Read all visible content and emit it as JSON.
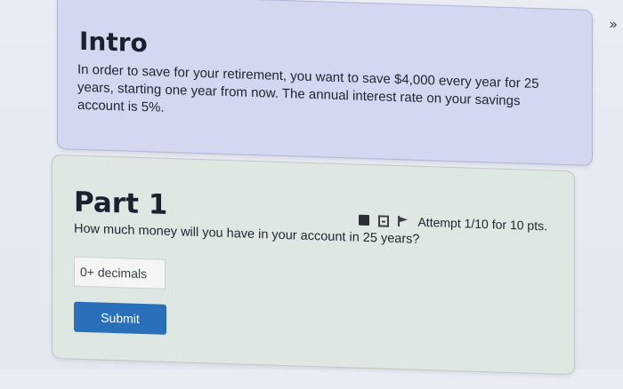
{
  "intro": {
    "title": "Intro",
    "text": "In order to save for your retirement, you want to save $4,000 every year for 25 years, starting one year from now. The annual interest rate on your savings account is 5%."
  },
  "part1": {
    "title": "Part 1",
    "attempt": "Attempt 1/10 for 10 pts.",
    "question": "How much money will you have in your account in 25 years?",
    "answer_placeholder": "0+ decimals",
    "answer_value": "",
    "submit_label": "Submit"
  },
  "icons": [
    "calculator-icon",
    "document-icon",
    "flag-icon"
  ],
  "colors": {
    "intro_bg": "#d3d8f0",
    "part_bg": "#dfe7e3",
    "submit_bg": "#2a6fb9"
  }
}
